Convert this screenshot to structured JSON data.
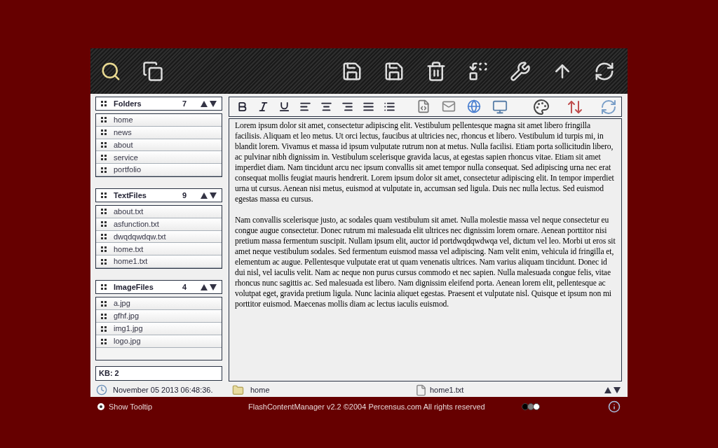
{
  "sections": [
    {
      "title": "Folders",
      "count": "7",
      "items": [
        "home",
        "news",
        "about",
        "service",
        "portfolio"
      ]
    },
    {
      "title": "TextFiles",
      "count": "9",
      "items": [
        "about.txt",
        "asfunction.txt",
        "dwqdqwdqw.txt",
        "home.txt",
        "home1.txt"
      ]
    },
    {
      "title": "ImageFiles",
      "count": "4",
      "items": [
        "a.jpg",
        "gfhf.jpg",
        "img1.jpg",
        "logo.jpg"
      ]
    }
  ],
  "kb": "KB: 2",
  "editor": {
    "paragraphs": [
      "Lorem ipsum dolor sit amet, consectetur adipiscing elit. Vestibulum pellentesque magna sit amet libero fringilla facilisis. Aliquam et leo metus. Ut orci lectus, faucibus at ultricies nec, rhoncus et libero. Vestibulum id turpis mi, in blandit lorem. Vivamus et massa id ipsum vulputate rutrum non at metus. Nulla facilisi. Etiam porta sollicitudin libero, ac pulvinar nibh dignissim in. Vestibulum scelerisque gravida lacus, at egestas sapien rhoncus vitae. Etiam sit amet imperdiet diam. Nam tincidunt arcu nec ipsum convallis sit amet tempor nulla consequat. Sed adipiscing urna nec erat consequat mollis feugiat mauris hendrerit. Lorem ipsum dolor sit amet, consectetur adipiscing elit. In tempor imperdiet urna ut cursus. Aenean nisi metus, euismod at vulputate in, accumsan sed ligula. Duis nec nulla lectus. Sed euismod egestas massa eu cursus.",
      "Nam convallis scelerisque justo, ac sodales quam vestibulum sit amet. Nulla molestie massa vel neque consectetur eu congue augue consectetur. Donec rutrum mi malesuada elit ultrices nec dignissim lorem ornare. Aenean porttitor nisi pretium massa fermentum suscipit. Nullam ipsum elit, auctor id portdwqdqwdwqa vel, dictum vel leo. Morbi ut eros sit amet neque vestibulum sodales. Sed fermentum euismod massa vel adipiscing. Nam velit enim, vehicula id fringilla et, elementum ac augue. Pellentesque vulputate erat ut quam venenatis ultrices. Nam varius aliquam tincidunt. Donec id dui nisl, vel iaculis velit. Nam ac neque non purus cursus commodo et nec sapien. Nulla malesuada congue felis, vitae rhoncus nunc sagittis ac. Sed malesuada est libero. Nam dignissim eleifend porta. Aenean lorem elit, pellentesque ac volutpat eget, gravida pretium ligula. Nunc lacinia aliquet egestas. Praesent et vulputate nisl. Quisque et ipsum non mi porttitor euismod. Maecenas mollis diam ac lectus iaculis euismod."
    ]
  },
  "status_bar": {
    "date": "November 05 2013 06:48:36.",
    "folder": "home",
    "file": "home1.txt"
  },
  "footer": {
    "tooltip": {
      "label": "Show Tooltip",
      "checked": true
    },
    "copyright": "FlashContentManager v2.2 ©2004 Percensus.com All rights reserved",
    "themes": [
      {
        "color": "#000000"
      },
      {
        "color": "#808080"
      },
      {
        "color": "#ffffff"
      }
    ]
  }
}
